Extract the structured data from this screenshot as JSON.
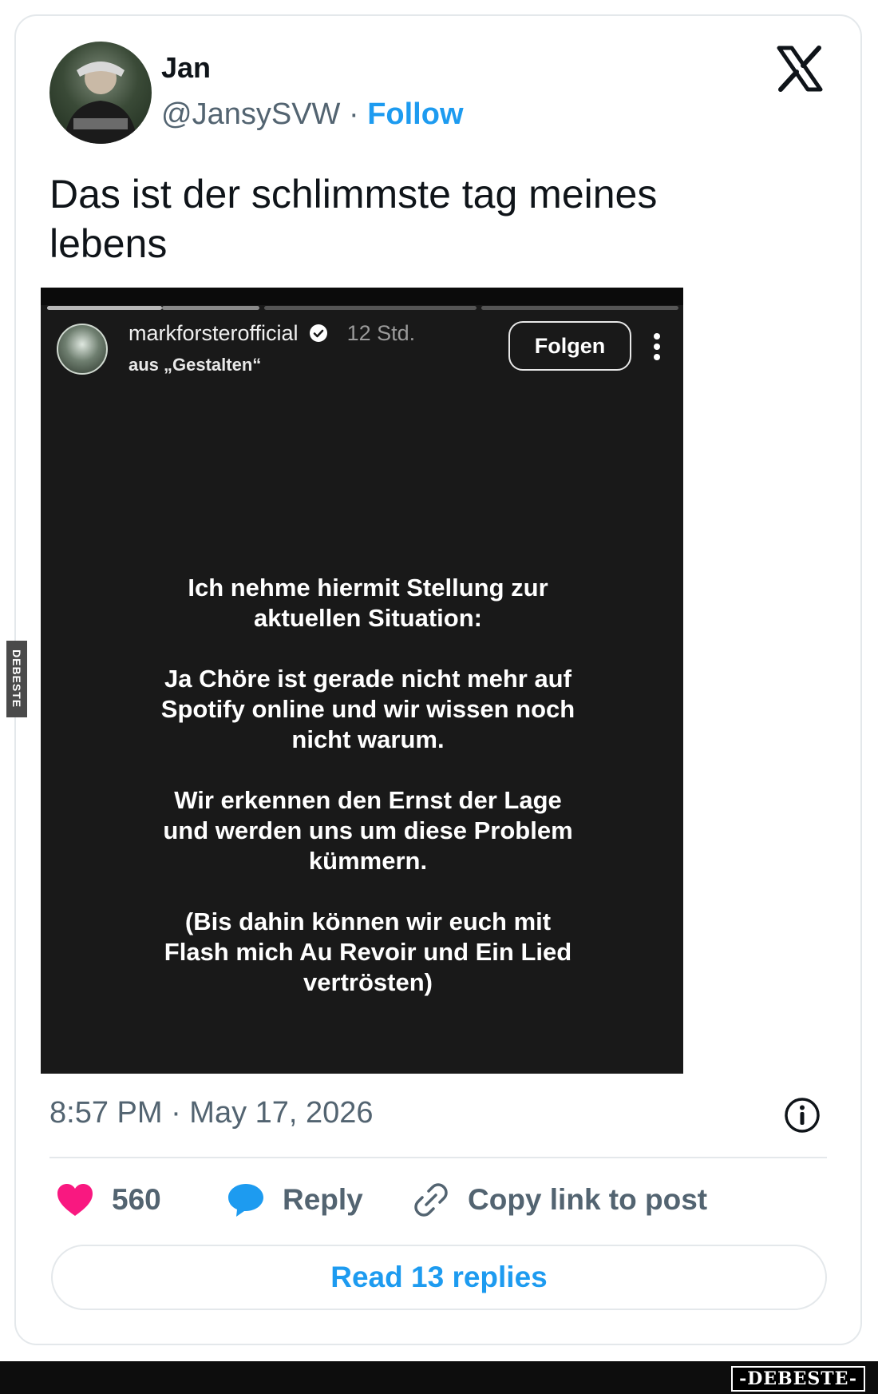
{
  "tweet": {
    "author_name": "Jan",
    "handle": "@JansySVW",
    "separator": " · ",
    "follow_label": "Follow",
    "text": "Das ist der schlimmste tag meines lebens",
    "timestamp": "8:57 PM · May 17, 2026",
    "likes_count": "560",
    "reply_label": "Reply",
    "copy_link_label": "Copy link to post",
    "read_replies_label": "Read 13 replies"
  },
  "story": {
    "username": "markforsterofficial",
    "time": "12 Std.",
    "subtitle": "aus „Gestalten“",
    "follow_label": "Folgen",
    "paragraphs": [
      "Ich nehme hiermit Stellung zur aktuellen Situation:",
      "Ja Chöre ist gerade nicht mehr auf Spotify online und wir wissen noch nicht warum.",
      "Wir erkennen den Ernst der Lage und werden uns um diese Problem kümmern.",
      "(Bis dahin können wir euch mit Flash mich Au Revoir und Ein Lied vertrösten)"
    ]
  },
  "watermark": {
    "side": "DEBESTE",
    "corner": "-DEBESTE-"
  },
  "colors": {
    "link": "#1d9bf0",
    "muted": "#536471",
    "like": "#f91880",
    "reply": "#1d9bf0"
  },
  "icons": [
    "x-logo-icon",
    "verified-icon",
    "more-vertical-icon",
    "info-icon",
    "heart-icon",
    "speech-bubble-icon",
    "link-icon"
  ]
}
